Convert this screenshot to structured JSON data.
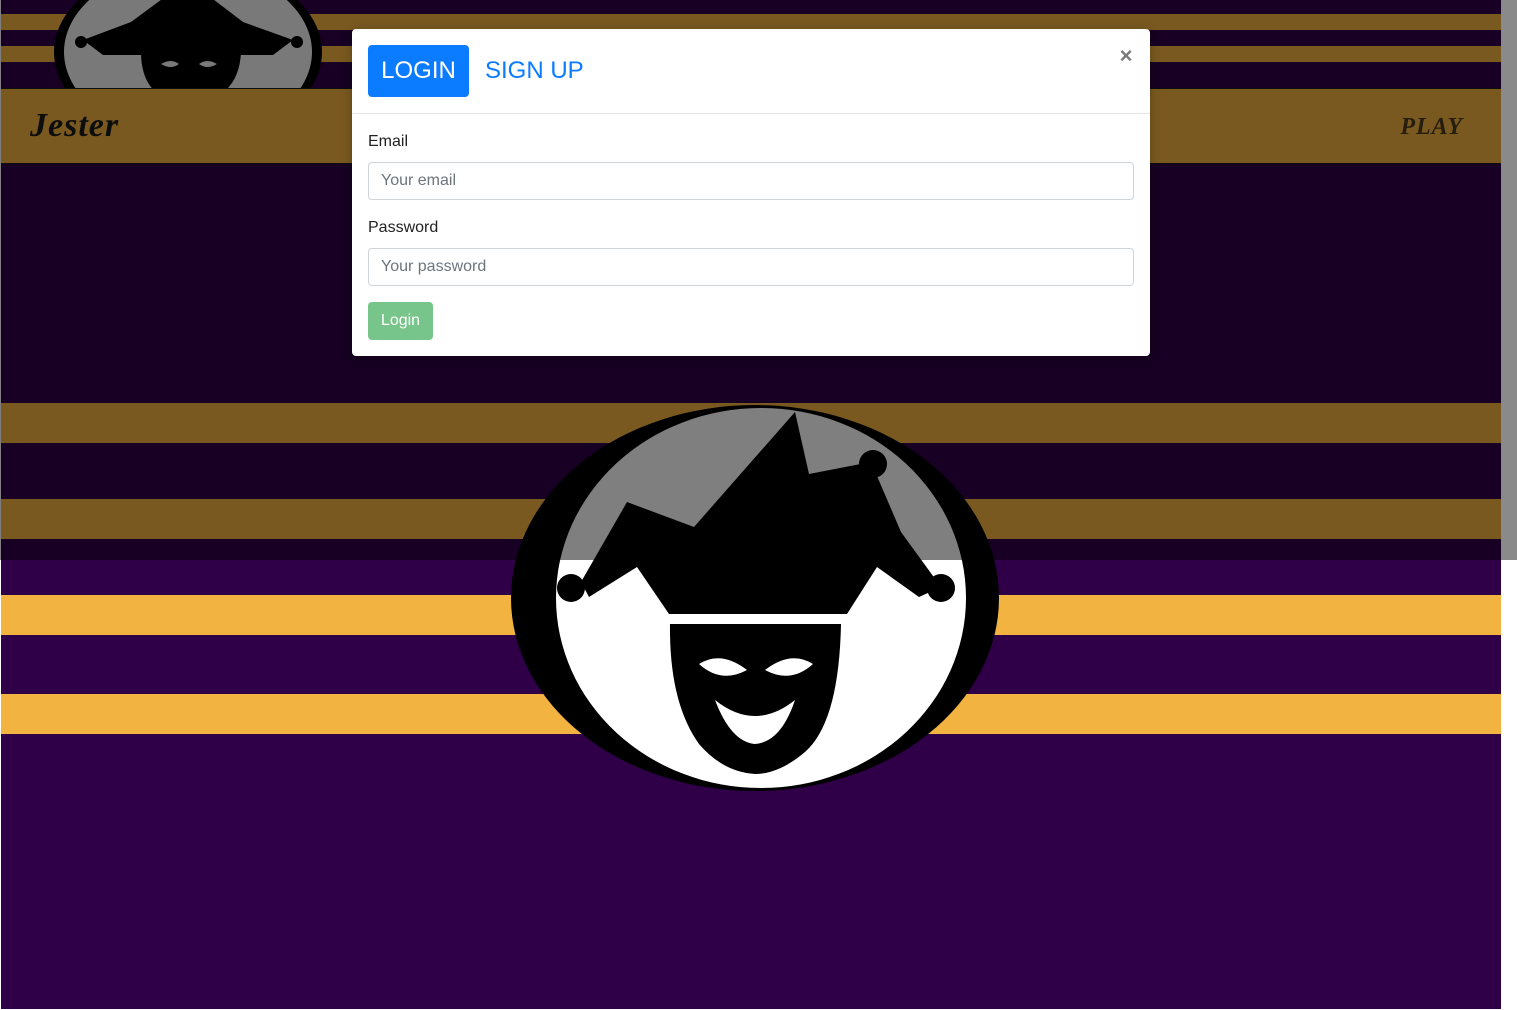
{
  "navbar": {
    "brand": "Jester",
    "play_link": "PLAY"
  },
  "modal": {
    "tabs": {
      "login": "LOGIN",
      "signup": "SIGN UP"
    },
    "close": "×",
    "email": {
      "label": "Email",
      "placeholder": "Your email"
    },
    "password": {
      "label": "Password",
      "placeholder": "Your password"
    },
    "submit": "Login"
  },
  "colors": {
    "page_background": "#2f0047",
    "stripe_gold": "#f2b340",
    "primary_blue": "#0b7bff",
    "success_green": "#77c58a"
  },
  "icons": {
    "logo": "jester-mask-icon",
    "close": "close-icon"
  }
}
